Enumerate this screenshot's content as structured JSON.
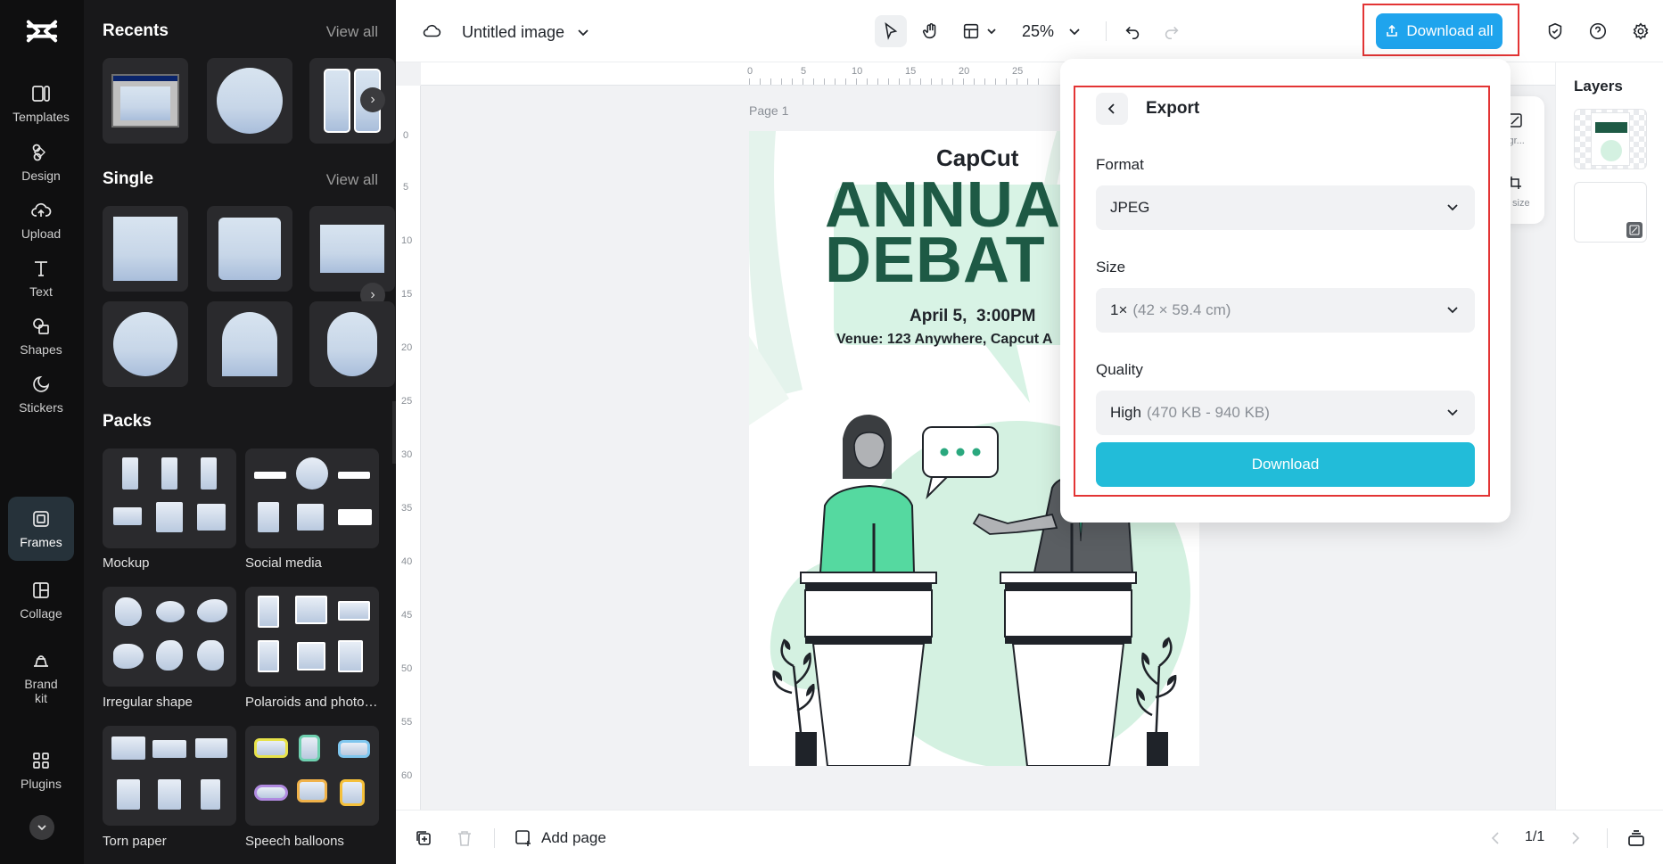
{
  "rail": {
    "items": [
      {
        "label": "Templates",
        "icon": "templates-icon"
      },
      {
        "label": "Design",
        "icon": "design-icon"
      },
      {
        "label": "Upload",
        "icon": "upload-icon"
      },
      {
        "label": "Text",
        "icon": "text-icon"
      },
      {
        "label": "Shapes",
        "icon": "shapes-icon"
      },
      {
        "label": "Stickers",
        "icon": "stickers-icon"
      },
      {
        "label": "Frames",
        "icon": "frames-icon",
        "active": true
      },
      {
        "label": "Collage",
        "icon": "collage-icon"
      },
      {
        "label": "Brand kit",
        "icon": "brand-kit-icon"
      },
      {
        "label": "Plugins",
        "icon": "plugins-icon"
      }
    ]
  },
  "panel": {
    "recents_title": "Recents",
    "single_title": "Single",
    "packs_title": "Packs",
    "view_all": "View all",
    "packs": [
      {
        "label": "Mockup"
      },
      {
        "label": "Social media"
      },
      {
        "label": "Irregular shape"
      },
      {
        "label": "Polaroids and photo f..."
      },
      {
        "label": "Torn paper"
      },
      {
        "label": "Speech balloons"
      }
    ]
  },
  "topbar": {
    "title": "Untitled image",
    "zoom": "25%",
    "download_all": "Download all"
  },
  "canvas": {
    "page_label": "Page 1",
    "ruler_h": [
      "0",
      "5",
      "10",
      "15",
      "20",
      "25"
    ],
    "ruler_v": [
      "0",
      "5",
      "10",
      "15",
      "20",
      "25",
      "30",
      "35",
      "40",
      "45",
      "50",
      "55",
      "60"
    ]
  },
  "poster": {
    "brand": "CapCut",
    "headline1": "ANNUA",
    "headline2": "DEBAT",
    "date": "April 5,  3:00PM",
    "venue": "Venue: 123 Anywhere, Capcut A"
  },
  "export": {
    "title": "Export",
    "format_label": "Format",
    "format_value": "JPEG",
    "size_label": "Size",
    "size_value": "1×",
    "size_detail": "(42 × 59.4 cm)",
    "quality_label": "Quality",
    "quality_value": "High",
    "quality_detail": "(470 KB - 940 KB)",
    "download_label": "Download"
  },
  "side_tools": {
    "bg_label": "kgr...",
    "resize_label": "size"
  },
  "layers": {
    "title": "Layers"
  },
  "bottombar": {
    "add_page": "Add page",
    "page_count": "1/1"
  },
  "colors": {
    "accent": "#1fa4ed",
    "download": "#22bcd9",
    "highlight": "#e33434",
    "poster_green": "#1e5a45",
    "mint": "#d8f3e5"
  }
}
